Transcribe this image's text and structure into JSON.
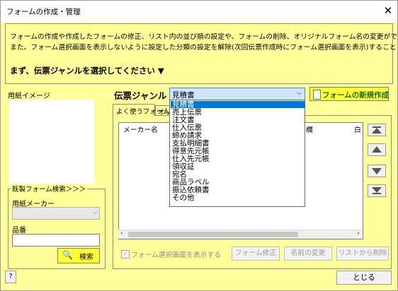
{
  "window": {
    "title": "フォームの作成・管理",
    "close_glyph": "✕"
  },
  "description": {
    "line1": "フォームの作成や作成したフォームの修正、リスト内の並び順の設定や、フォームの削除、オリジナルフォーム名の変更ができます。",
    "line2": "また、フォーム選択画面を表示しないように設定した分類の設定を解除(次回伝票作成時にフォーム選択画面を表示)することもできます。",
    "instruction": "まず、伝票ジャンルを選択してください ▼"
  },
  "left": {
    "preview_label": "用紙イメージ",
    "search_group_title": "既製フォーム検索＞＞＞",
    "maker_label": "用紙メーカー",
    "maker_value": "",
    "part_label": "品番",
    "part_value": "",
    "search_button": "検索",
    "search_icon": "magnifier-icon"
  },
  "genre": {
    "label": "伝票ジャンル",
    "selected": "見積書",
    "new_form_button": "フォームの新規作成",
    "options": [
      "見積書",
      "売上伝票",
      "注文書",
      "仕入伝票",
      "締め請求",
      "支払明細書",
      "得意先元帳",
      "仕入先元帳",
      "領収証",
      "宛名",
      "商品ラベル",
      "振込依頼書",
      "その他"
    ],
    "highlighted_index": 0
  },
  "tabs": [
    {
      "label": "よく使うフォーム"
    },
    {
      "label": "オリ"
    }
  ],
  "list": {
    "columns": [
      "メーカー名",
      "欄",
      "白"
    ]
  },
  "move_buttons": [
    "move-top-icon",
    "move-up-icon",
    "move-down-icon",
    "move-bottom-icon"
  ],
  "bottom": {
    "show_select_checkbox_label": "フォーム選択画面を表示する",
    "show_select_checked": true,
    "edit_button": "フォーム修正",
    "rename_button": "名前の変更",
    "delete_button": "リストから削除",
    "help_button": "?",
    "close_button": "とじる"
  },
  "colors": {
    "accent_yellow": "#ffff33",
    "panel_yellow": "#ffff99",
    "selection_blue": "#0078d7"
  }
}
